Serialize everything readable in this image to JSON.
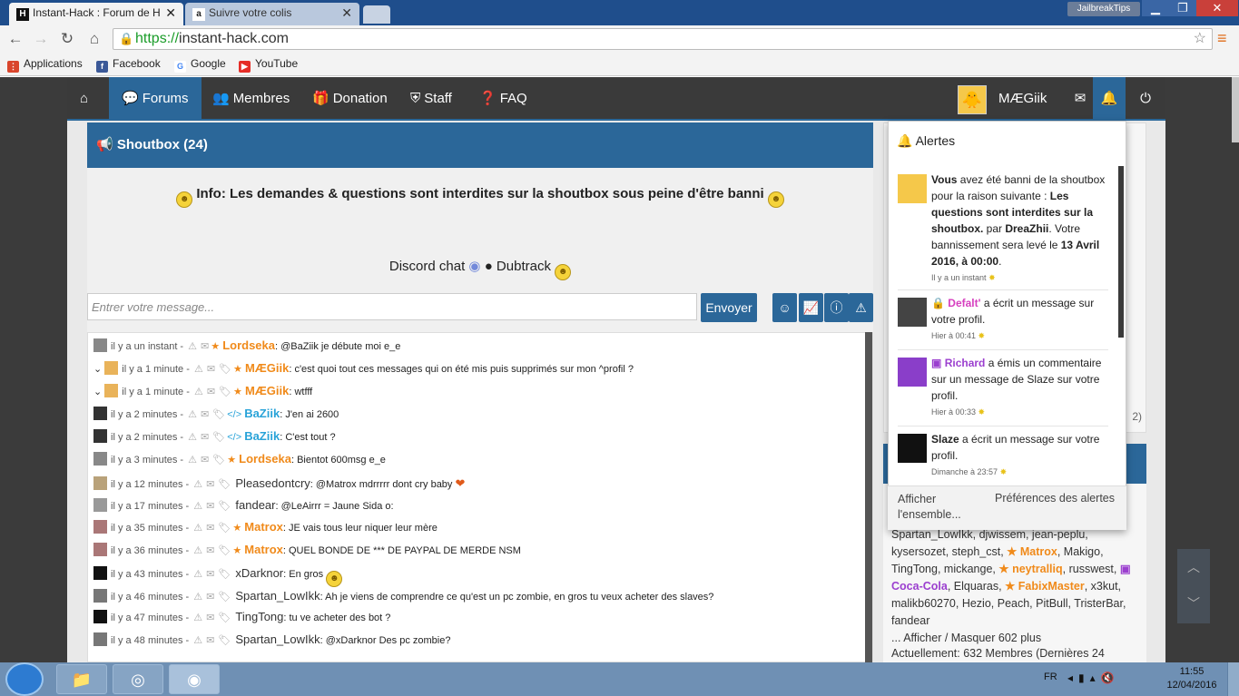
{
  "browser": {
    "tabs": [
      {
        "title": "Instant-Hack : Forum de H",
        "favicon": "H",
        "close": "✕"
      },
      {
        "title": "Suivre votre colis",
        "favicon": "a",
        "close": "✕"
      }
    ],
    "profile_name": "JailbreakTips",
    "window_buttons": {
      "minimize": "▁",
      "maximize": "❐",
      "close": "✕"
    },
    "url_protocol": "https://",
    "url_host": "instant-hack.com",
    "bookmarks": [
      "Applications",
      "Facebook",
      "Google",
      "YouTube"
    ]
  },
  "site": {
    "nav": {
      "forums": "Forums",
      "membres": "Membres",
      "donation": "Donation",
      "staff": "Staff",
      "faq": "FAQ",
      "username": "MÆGiik"
    },
    "shoutbox": {
      "title": "Shoutbox (24)",
      "info": "Info: Les demandes & questions sont interdites sur la shoutbox sous peine d'être banni",
      "discord": "Discord chat",
      "sep": "●",
      "dubtrack": "Dubtrack",
      "input_placeholder": "Entrer votre message...",
      "send": "Envoyer",
      "messages": [
        {
          "time": "il y a un instant -",
          "user": "Lordseka",
          "text": ": @BaZiik je débute moi e_e"
        },
        {
          "time": "il y a 1 minute -",
          "user": "MÆGiik",
          "text": ": c'est quoi tout ces messages qui on été mis puis supprimés sur mon ^profil ?"
        },
        {
          "time": "il y a 1 minute -",
          "user": "MÆGiik",
          "text": ": wtfff"
        },
        {
          "time": "il y a 2 minutes -",
          "user": "BaZiik",
          "text": ": J'en ai 2600"
        },
        {
          "time": "il y a 2 minutes -",
          "user": "BaZiik",
          "text": ": C'est tout ?"
        },
        {
          "time": "il y a 3 minutes -",
          "user": "Lordseka",
          "text": ": Bientot 600msg e_e"
        },
        {
          "time": "il y a 12 minutes -",
          "user": "Pleasedontcry",
          "text": ": @Matrox mdrrrrr dont cry baby"
        },
        {
          "time": "il y a 17 minutes -",
          "user": "fandear",
          "text": ": @LeAirrr = Jaune Sida o:"
        },
        {
          "time": "il y a 35 minutes -",
          "user": "Matrox",
          "text": ": JE vais tous leur niquer leur mère"
        },
        {
          "time": "il y a 36 minutes -",
          "user": "Matrox",
          "text": ": QUEL BONDE DE *** DE PAYPAL DE MERDE NSM"
        },
        {
          "time": "il y a 43 minutes -",
          "user": "xDarknor",
          "text": ": En gros"
        },
        {
          "time": "il y a 46 minutes -",
          "user": "Spartan_LowIkk",
          "text": ": Ah je viens de comprendre ce qu'est un pc zombie, en gros tu veux acheter des slaves?"
        },
        {
          "time": "il y a 47 minutes -",
          "user": "TingTong",
          "text": ": tu ve acheter des bot ?"
        },
        {
          "time": "il y a 48 minutes -",
          "user": "Spartan_LowIkk",
          "text": ": @xDarknor Des pc zombie?"
        }
      ]
    },
    "alerts": {
      "title": "Alertes",
      "items": [
        {
          "t1": "Vous",
          "t2": " avez été banni de la shoutbox pour la raison suivante : ",
          "t3": "Les questions sont interdites sur la shoutbox.",
          "t4": " par ",
          "t5": "DreaZhii",
          "t6": ". Votre bannissement sera levé le ",
          "t7": "13 Avril 2016, à 00:00",
          "t8": ".",
          "time": "Il y a un instant"
        },
        {
          "user": "Defalt'",
          "text": " a écrit un message sur votre profil.",
          "time": "Hier à 00:41"
        },
        {
          "user": "Richard",
          "text": " a émis un commentaire sur un message de Slaze sur votre profil.",
          "time": "Hier à 00:33"
        },
        {
          "user": "Slaze",
          "text": " a écrit un message sur votre profil.",
          "time": "Dimanche à 23:57"
        }
      ],
      "show_all": "Afficher l'ensemble...",
      "prefs": "Préférences des alertes"
    },
    "sidebar": {
      "partial_num": "2)",
      "line1": "Spartan_LowIkk, djwissem, jean-peplu,",
      "line2": "kysersozet, steph_cst,",
      "matrox": "Matrox",
      "line2b": ", Makigo,",
      "line3": "TingTong, mickange,",
      "neytralliq": "neytralliq",
      "line3b": ", russwest,",
      "cocacola": "Coca-Cola",
      "line4": ", Elquaras,",
      "fabix": "FabixMaster",
      "line4b": ", x3kut,",
      "line5": "malikb60270, Hezio, Peach, PitBull, TristerBar,",
      "line6": "fandear",
      "toggle": "... Afficher / Masquer 602 plus",
      "now": "Actuellement: 632 Membres (Dernières 24"
    }
  },
  "taskbar": {
    "lang": "FR",
    "time": "11:55",
    "date": "12/04/2016"
  },
  "colors": {
    "accent": "#2b6799",
    "orange_user": "#f08a1a",
    "blue_user": "#29a3d8",
    "purple": "#9b3fcf"
  }
}
